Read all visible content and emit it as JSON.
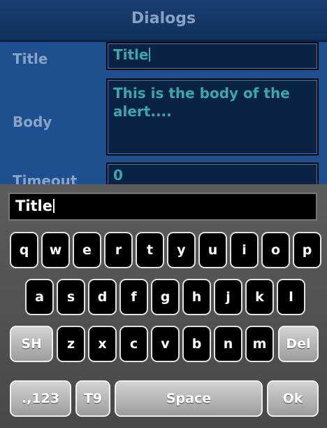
{
  "header": {
    "title": "Dialogs"
  },
  "form": {
    "title_label": "Title",
    "title_value": "Title",
    "body_label": "Body",
    "body_value": "This is the body of the alert....",
    "timeout_label": "Timeout",
    "timeout_value": "0"
  },
  "keyboard": {
    "input_value": "Title",
    "row1": [
      "q",
      "w",
      "e",
      "r",
      "t",
      "y",
      "u",
      "i",
      "o",
      "p"
    ],
    "row2": [
      "a",
      "s",
      "d",
      "f",
      "g",
      "h",
      "j",
      "k",
      "l"
    ],
    "row3": [
      "z",
      "x",
      "c",
      "v",
      "b",
      "n",
      "m"
    ],
    "shift_label": "SH",
    "delete_label": "Del",
    "numbers_label": ".,123",
    "t9_label": "T9",
    "space_label": "Space",
    "ok_label": "Ok"
  },
  "colors": {
    "header": "#10305c",
    "form_bg": "#1e4f8e",
    "field_text": "#3aa6ae",
    "keyboard_bg": "#555555"
  }
}
